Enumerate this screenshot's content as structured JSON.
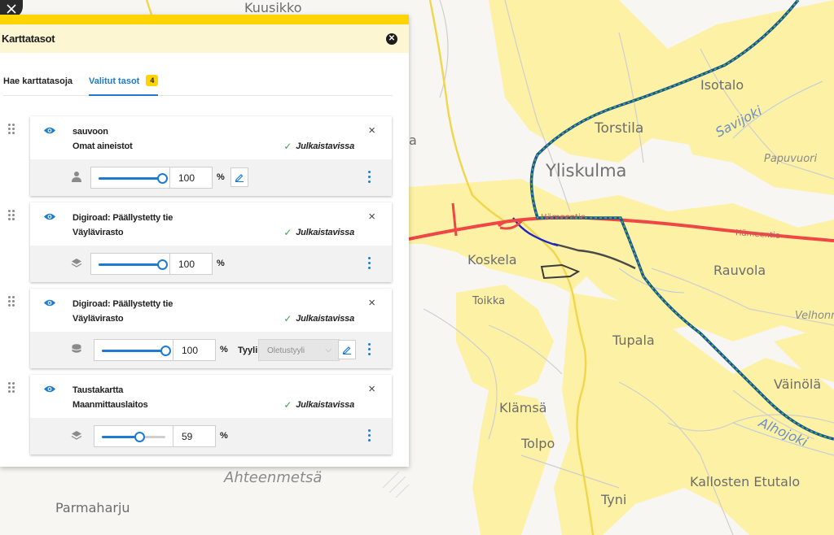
{
  "map": {
    "places": [
      {
        "name": "Kuusikko",
        "size": "mid"
      },
      {
        "name": "Isotalo",
        "size": "mid"
      },
      {
        "name": "Torstila",
        "size": "mid"
      },
      {
        "name": "Yliskulma",
        "size": "big"
      },
      {
        "name": "Papuvuori",
        "size": "sm"
      },
      {
        "name": "Savijoki",
        "size": "water"
      },
      {
        "name": "Koskela",
        "size": "mid"
      },
      {
        "name": "Rauvola",
        "size": "mid"
      },
      {
        "name": "Toikka",
        "size": "sm"
      },
      {
        "name": "Velhonm",
        "size": "sm"
      },
      {
        "name": "Tupala",
        "size": "mid"
      },
      {
        "name": "Väinölä",
        "size": "mid"
      },
      {
        "name": "Klämsä",
        "size": "mid"
      },
      {
        "name": "Alhojoki",
        "size": "water"
      },
      {
        "name": "Tolpo",
        "size": "mid"
      },
      {
        "name": "Ahteenmetsä",
        "size": "hill"
      },
      {
        "name": "Kallosten Etutalo",
        "size": "mid"
      },
      {
        "name": "Parmaharju",
        "size": "mid"
      },
      {
        "name": "Tyni",
        "size": "mid"
      },
      {
        "name": "a",
        "size": "mid"
      }
    ],
    "road_labels": [
      "Hämeentie",
      "Hämeentie"
    ],
    "colors": {
      "highway": "#ef4646",
      "rail_green": "#3cc43c",
      "rail_blue": "#1f4e9c",
      "land_yellow": "#fdf1a5",
      "road_yellow": "#f2d64a"
    }
  },
  "panel": {
    "title": "Karttatasot",
    "close_icon": "close-circle-icon",
    "tabs": [
      {
        "label": "Hae karttatasoja",
        "active": false
      },
      {
        "label": "Valitut tasot",
        "active": true,
        "badge": "4"
      }
    ],
    "accent": "#1d7bd1",
    "layers": [
      {
        "name": "sauvoon",
        "source": "Omat aineistot",
        "status": "Julkaistavissa",
        "opacity": 100,
        "type_icon": "user-icon",
        "has_edit": true,
        "style_label": "",
        "style_value": ""
      },
      {
        "name": "Digiroad: Päällystetty tie",
        "source": "Väylävirasto",
        "status": "Julkaistavissa",
        "opacity": 100,
        "type_icon": "layers-icon",
        "has_edit": false,
        "style_label": "",
        "style_value": ""
      },
      {
        "name": "Digiroad: Päällystetty tie",
        "source": "Väylävirasto",
        "status": "Julkaistavissa",
        "opacity": 100,
        "type_icon": "database-icon",
        "has_edit": true,
        "style_label": "Tyyli",
        "style_value": "Oletustyyli"
      },
      {
        "name": "Taustakartta",
        "source": "Maanmittauslaitos",
        "status": "Julkaistavissa",
        "opacity": 59,
        "type_icon": "layers-icon",
        "has_edit": false,
        "style_label": "",
        "style_value": ""
      }
    ],
    "percent_sign": "%"
  }
}
